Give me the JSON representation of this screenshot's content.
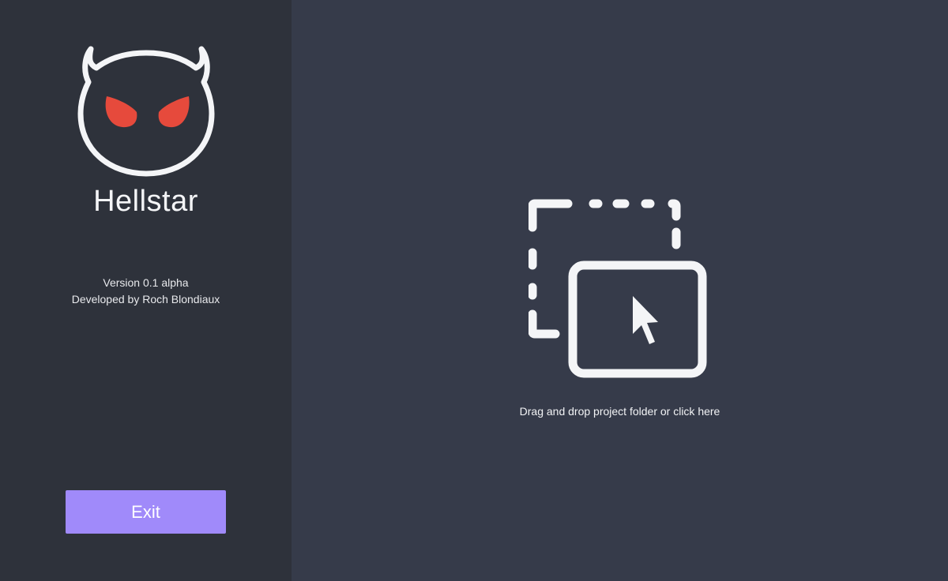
{
  "app": {
    "title": "Hellstar",
    "logo_icon": "devil-face-icon",
    "version": "Version 0.1 alpha",
    "developer": "Developed by Roch Blondiaux"
  },
  "sidebar": {
    "exit_label": "Exit"
  },
  "dropzone": {
    "icon": "drag-drop-folder-icon",
    "text": "Drag and drop project folder or click here"
  },
  "colors": {
    "sidebar_bg": "#2e323b",
    "main_bg": "#363b4a",
    "accent": "#a08afa",
    "logo_eyes": "#e64a3c",
    "foreground": "#f4f5f7"
  }
}
